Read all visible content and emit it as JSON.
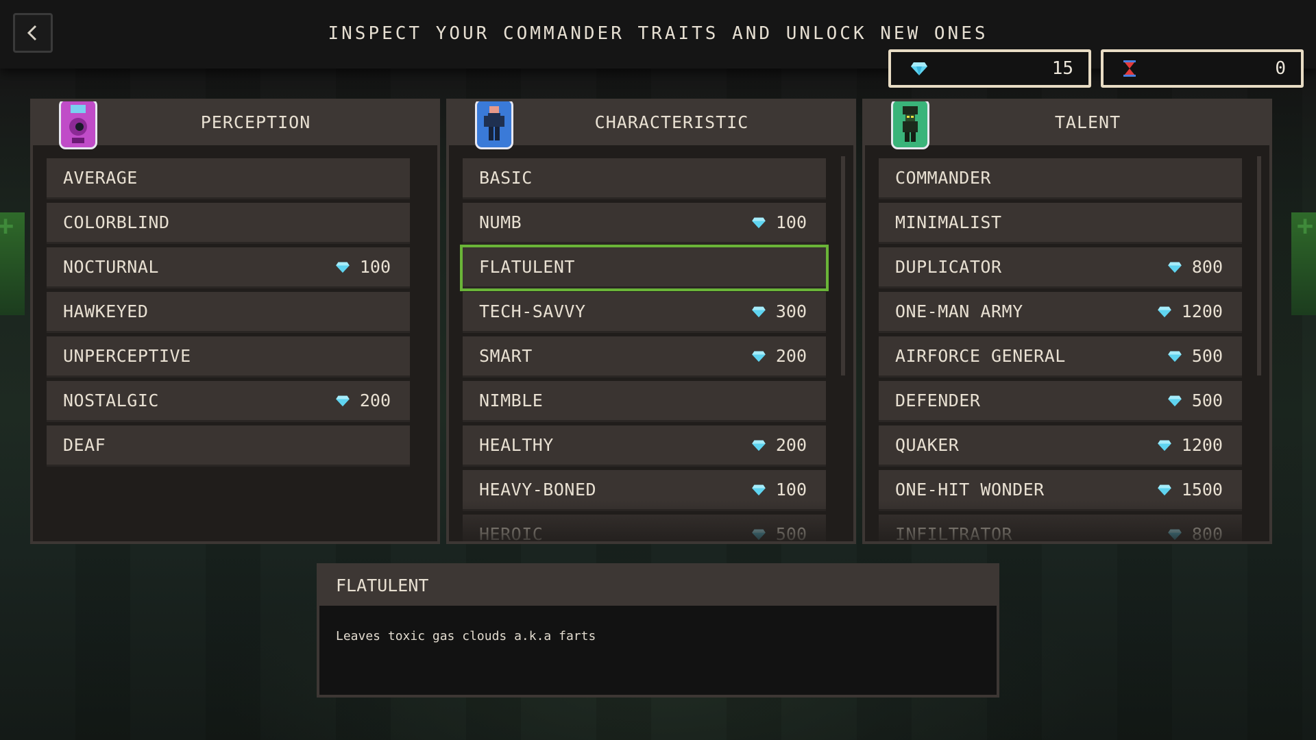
{
  "header": {
    "title": "INSPECT YOUR COMMANDER TRAITS AND UNLOCK NEW ONES",
    "back_icon": "chevron-left-icon"
  },
  "currency": {
    "gems": {
      "icon": "gem-icon",
      "value": "15"
    },
    "time": {
      "icon": "hourglass-icon",
      "value": "0"
    }
  },
  "colors": {
    "gem": "#5fd4f0",
    "hourglass": "#e23a3a",
    "selected_outline": "#6ab438",
    "panel_border": "#3d3734",
    "row_bg": "#3a3431"
  },
  "panels": [
    {
      "title": "PERCEPTION",
      "avatar_icon": "pink-eye-creature-icon",
      "rows": [
        {
          "label": "AVERAGE",
          "cost": ""
        },
        {
          "label": "COLORBLIND",
          "cost": ""
        },
        {
          "label": "NOCTURNAL",
          "cost": "100"
        },
        {
          "label": "HAWKEYED",
          "cost": ""
        },
        {
          "label": "UNPERCEPTIVE",
          "cost": ""
        },
        {
          "label": "NOSTALGIC",
          "cost": "200"
        },
        {
          "label": "DEAF",
          "cost": ""
        }
      ]
    },
    {
      "title": "CHARACTERISTIC",
      "avatar_icon": "blue-soldier-icon",
      "rows": [
        {
          "label": "BASIC",
          "cost": ""
        },
        {
          "label": "NUMB",
          "cost": "100"
        },
        {
          "label": "FLATULENT",
          "cost": "",
          "selected": true
        },
        {
          "label": "TECH-SAVVY",
          "cost": "300"
        },
        {
          "label": "SMART",
          "cost": "200"
        },
        {
          "label": "NIMBLE",
          "cost": ""
        },
        {
          "label": "HEALTHY",
          "cost": "200"
        },
        {
          "label": "HEAVY-BONED",
          "cost": "100"
        },
        {
          "label": "HEROIC",
          "cost": "500"
        }
      ]
    },
    {
      "title": "TALENT",
      "avatar_icon": "green-helmet-soldier-icon",
      "rows": [
        {
          "label": "COMMANDER",
          "cost": ""
        },
        {
          "label": "MINIMALIST",
          "cost": ""
        },
        {
          "label": "DUPLICATOR",
          "cost": "800"
        },
        {
          "label": "ONE-MAN ARMY",
          "cost": "1200"
        },
        {
          "label": "AIRFORCE GENERAL",
          "cost": "500"
        },
        {
          "label": "DEFENDER",
          "cost": "500"
        },
        {
          "label": "QUAKER",
          "cost": "1200"
        },
        {
          "label": "ONE-HIT WONDER",
          "cost": "1500"
        },
        {
          "label": "INFILTRATOR",
          "cost": "800"
        }
      ]
    }
  ],
  "description": {
    "title": "FLATULENT",
    "text": "Leaves toxic gas clouds a.k.a farts"
  }
}
